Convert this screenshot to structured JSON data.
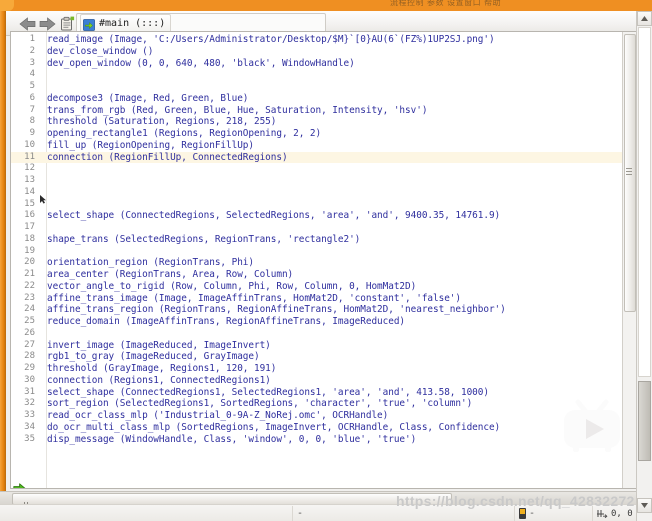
{
  "window": {
    "top_strip_ghost_text": "流程控制        参数     设置窗口     帮助"
  },
  "toolbar": {
    "back_label": "back-arrow",
    "forward_label": "forward-arrow",
    "clipboard_label": "clipboard",
    "tab": {
      "icon": "procedure-icon",
      "label": "#main (:::)"
    }
  },
  "editor": {
    "current_line": 11,
    "execution_arrow_line": 35,
    "lines": [
      {
        "n": 1,
        "text": "read_image (Image, 'C:/Users/Administrator/Desktop/$M}`[0}AU(6`(FZ%)1UP2SJ.png')"
      },
      {
        "n": 2,
        "text": "dev_close_window ()"
      },
      {
        "n": 3,
        "text": "dev_open_window (0, 0, 640, 480, 'black', WindowHandle)"
      },
      {
        "n": 4,
        "text": ""
      },
      {
        "n": 5,
        "text": ""
      },
      {
        "n": 6,
        "text": "decompose3 (Image, Red, Green, Blue)"
      },
      {
        "n": 7,
        "text": "trans_from_rgb (Red, Green, Blue, Hue, Saturation, Intensity, 'hsv')"
      },
      {
        "n": 8,
        "text": "threshold (Saturation, Regions, 218, 255)"
      },
      {
        "n": 9,
        "text": "opening_rectangle1 (Regions, RegionOpening, 2, 2)"
      },
      {
        "n": 10,
        "text": "fill_up (RegionOpening, RegionFillUp)"
      },
      {
        "n": 11,
        "text": "connection (RegionFillUp, ConnectedRegions)"
      },
      {
        "n": 12,
        "text": ""
      },
      {
        "n": 13,
        "text": ""
      },
      {
        "n": 14,
        "text": ""
      },
      {
        "n": 15,
        "text": ""
      },
      {
        "n": 16,
        "text": "select_shape (ConnectedRegions, SelectedRegions, 'area', 'and', 9400.35, 14761.9)"
      },
      {
        "n": 17,
        "text": ""
      },
      {
        "n": 18,
        "text": "shape_trans (SelectedRegions, RegionTrans, 'rectangle2')"
      },
      {
        "n": 19,
        "text": ""
      },
      {
        "n": 20,
        "text": "orientation_region (RegionTrans, Phi)"
      },
      {
        "n": 21,
        "text": "area_center (RegionTrans, Area, Row, Column)"
      },
      {
        "n": 22,
        "text": "vector_angle_to_rigid (Row, Column, Phi, Row, Column, 0, HomMat2D)"
      },
      {
        "n": 23,
        "text": "affine_trans_image (Image, ImageAffinTrans, HomMat2D, 'constant', 'false')"
      },
      {
        "n": 24,
        "text": "affine_trans_region (RegionTrans, RegionAffineTrans, HomMat2D, 'nearest_neighbor')"
      },
      {
        "n": 25,
        "text": "reduce_domain (ImageAffinTrans, RegionAffineTrans, ImageReduced)"
      },
      {
        "n": 26,
        "text": ""
      },
      {
        "n": 27,
        "text": "invert_image (ImageReduced, ImageInvert)"
      },
      {
        "n": 28,
        "text": "rgb1_to_gray (ImageReduced, GrayImage)"
      },
      {
        "n": 29,
        "text": "threshold (GrayImage, Regions1, 120, 191)"
      },
      {
        "n": 30,
        "text": "connection (Regions1, ConnectedRegions1)"
      },
      {
        "n": 31,
        "text": "select_shape (ConnectedRegions1, SelectedRegions1, 'area', 'and', 413.58, 1000)"
      },
      {
        "n": 32,
        "text": "sort_region (SelectedRegions1, SortedRegions, 'character', 'true', 'column')"
      },
      {
        "n": 33,
        "text": "read_ocr_class_mlp ('Industrial_0-9A-Z_NoRej.omc', OCRHandle)"
      },
      {
        "n": 34,
        "text": "do_ocr_multi_class_mlp (SortedRegions, ImageInvert, OCRHandle, Class, Confidence)"
      },
      {
        "n": 35,
        "text": "disp_message (WindowHandle, Class, 'window', 0, 0, 'blue', 'true')"
      }
    ]
  },
  "statusbar": {
    "middle_value": "-",
    "battery_value": "-",
    "coordinates": "0, 0"
  },
  "watermarks": {
    "url": "https://blog.csdn.net/qq_42832272",
    "play_badge": "bilibili-play-icon"
  },
  "colors": {
    "accent_orange": "#ef8f22",
    "code_text": "#2f2f9e",
    "line_number": "#8a8a8a",
    "current_line_bg": "#fdf6e3",
    "editor_bg": "#ffffff"
  }
}
